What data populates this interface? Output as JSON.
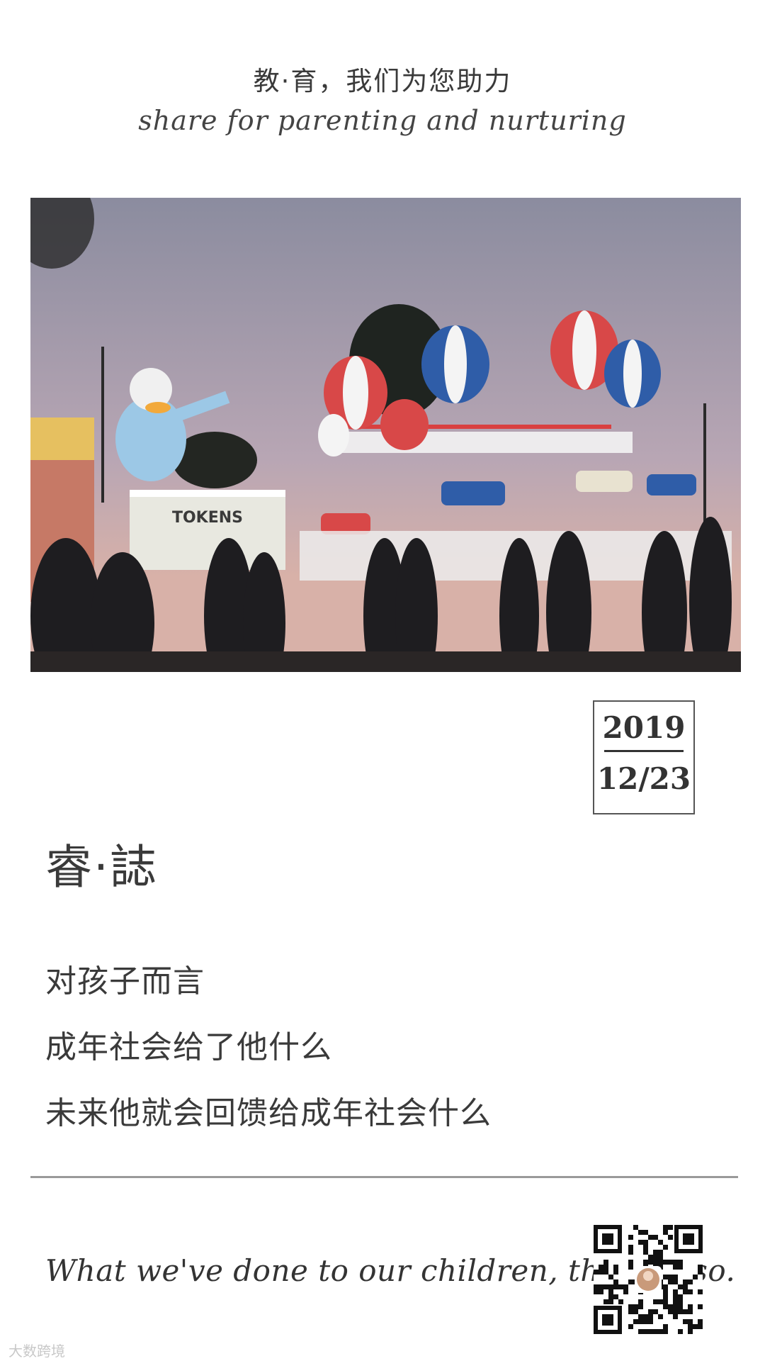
{
  "header": {
    "title": "教·育，我们为您助力",
    "subtitle": "share for parenting and nurturing"
  },
  "photo": {
    "sign_text": "TOKENS",
    "sky_top": "#8e8ea0",
    "sky_bottom": "#dcb4b0"
  },
  "date": {
    "year": "2019",
    "day": "12/23"
  },
  "section": {
    "title": "睿·誌"
  },
  "body": {
    "lines": [
      "对孩子而言",
      "成年社会给了他什么",
      "未来他就会回馈给成年社会什么"
    ]
  },
  "footer": {
    "quote": "What we've done to our children, they do so.",
    "watermark": "大数跨境"
  },
  "colors": {
    "accent": "#3a3a3a",
    "divider": "#9a9a9a"
  }
}
